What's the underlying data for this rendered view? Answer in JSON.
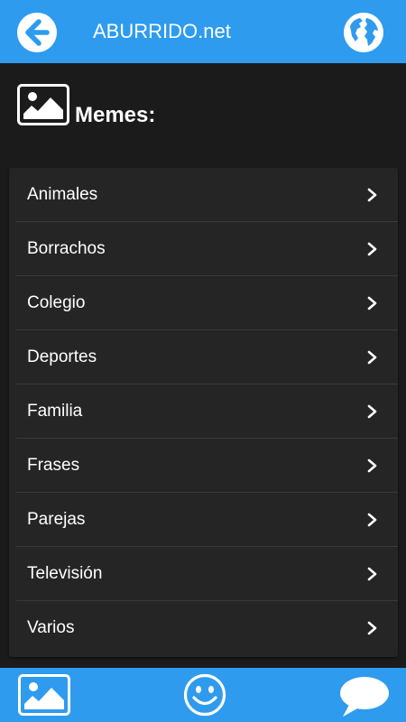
{
  "header": {
    "title": "ABURRIDO.net",
    "back_icon": "arrow-left-circle-icon",
    "globe_icon": "globe-icon"
  },
  "section": {
    "title": "Memes:",
    "icon": "image-icon"
  },
  "categories": [
    {
      "label": "Animales"
    },
    {
      "label": "Borrachos"
    },
    {
      "label": "Colegio"
    },
    {
      "label": "Deportes"
    },
    {
      "label": "Familia"
    },
    {
      "label": "Frases"
    },
    {
      "label": "Parejas"
    },
    {
      "label": "Televisión"
    },
    {
      "label": "Varios"
    }
  ],
  "bottom_nav": {
    "items": [
      "image-icon",
      "smiley-icon",
      "chat-bubble-icon"
    ]
  },
  "colors": {
    "accent": "#2e9bef",
    "background": "#1b1b1b",
    "card": "#252525",
    "text": "#ffffff"
  }
}
